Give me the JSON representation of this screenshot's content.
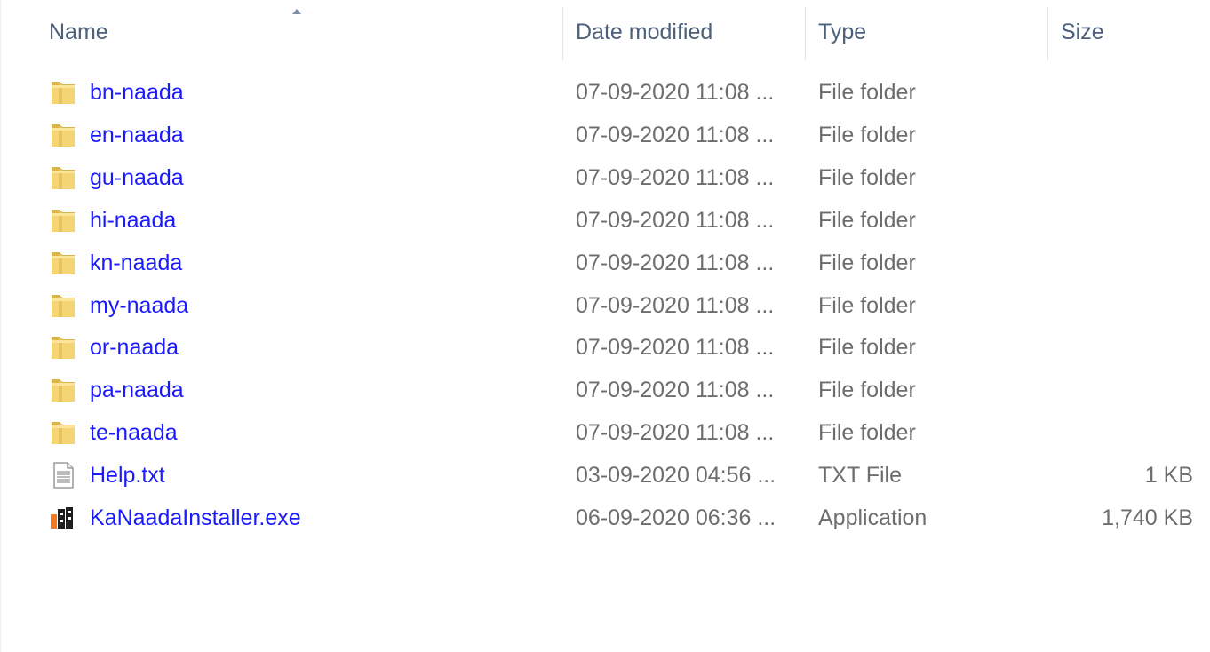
{
  "columns": {
    "name": "Name",
    "date": "Date modified",
    "type": "Type",
    "size": "Size"
  },
  "rows": [
    {
      "name": "bn-naada",
      "date": "07-09-2020 11:08 ...",
      "type": "File folder",
      "size": "",
      "icon": "folder-icon"
    },
    {
      "name": "en-naada",
      "date": "07-09-2020 11:08 ...",
      "type": "File folder",
      "size": "",
      "icon": "folder-icon"
    },
    {
      "name": "gu-naada",
      "date": "07-09-2020 11:08 ...",
      "type": "File folder",
      "size": "",
      "icon": "folder-icon"
    },
    {
      "name": "hi-naada",
      "date": "07-09-2020 11:08 ...",
      "type": "File folder",
      "size": "",
      "icon": "folder-icon"
    },
    {
      "name": "kn-naada",
      "date": "07-09-2020 11:08 ...",
      "type": "File folder",
      "size": "",
      "icon": "folder-icon"
    },
    {
      "name": "my-naada",
      "date": "07-09-2020 11:08 ...",
      "type": "File folder",
      "size": "",
      "icon": "folder-icon"
    },
    {
      "name": "or-naada",
      "date": "07-09-2020 11:08 ...",
      "type": "File folder",
      "size": "",
      "icon": "folder-icon"
    },
    {
      "name": "pa-naada",
      "date": "07-09-2020 11:08 ...",
      "type": "File folder",
      "size": "",
      "icon": "folder-icon"
    },
    {
      "name": "te-naada",
      "date": "07-09-2020 11:08 ...",
      "type": "File folder",
      "size": "",
      "icon": "folder-icon"
    },
    {
      "name": "Help.txt",
      "date": "03-09-2020 04:56 ...",
      "type": "TXT File",
      "size": "1 KB",
      "icon": "text-file-icon"
    },
    {
      "name": "KaNaadaInstaller.exe",
      "date": "06-09-2020 06:36 ...",
      "type": "Application",
      "size": "1,740 KB",
      "icon": "application-icon"
    }
  ],
  "colors": {
    "name_link": "#1a1aff",
    "header_text": "#4c607a",
    "detail_text": "#6d6d6d"
  }
}
